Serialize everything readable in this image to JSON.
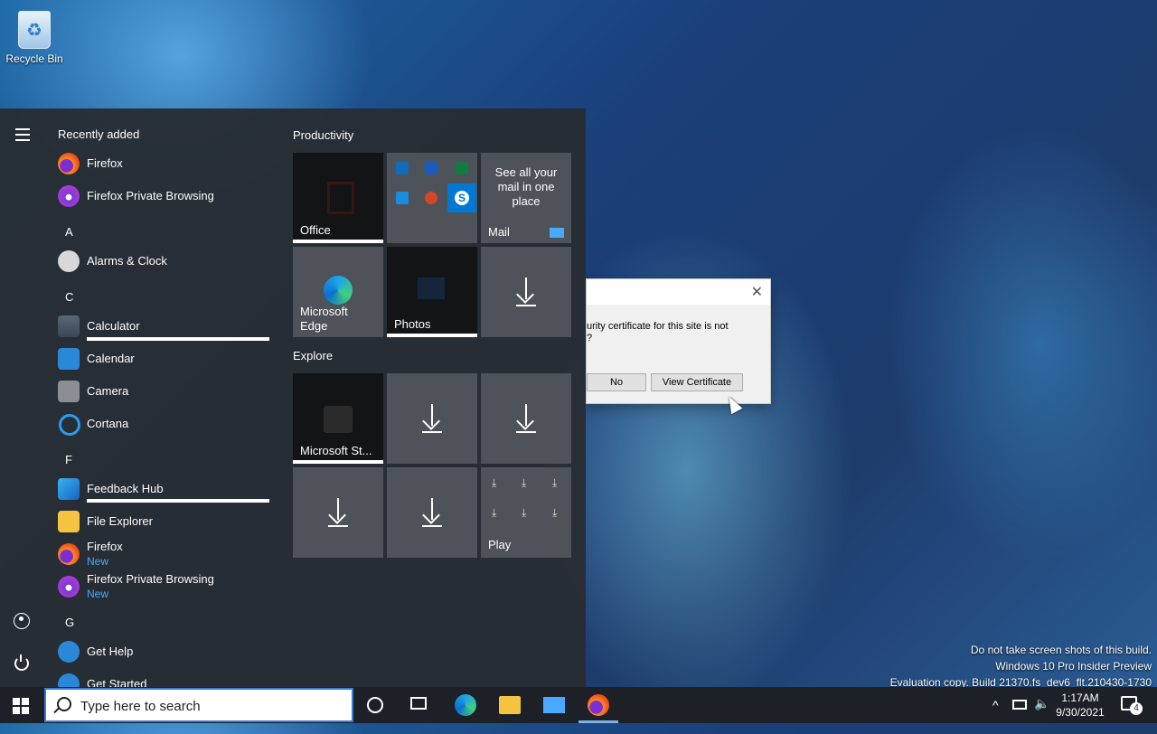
{
  "desktop": {
    "recycle_bin_label": "Recycle Bin",
    "watermark": [
      "Do not take screen shots of this build.",
      "Windows 10 Pro Insider Preview",
      "Evaluation copy. Build 21370.fs_dev6_flt.210430-1730"
    ]
  },
  "dialog": {
    "message_line1": "urity certificate for this site is not",
    "message_line2": "?",
    "no_label": "No",
    "view_cert_label": "View Certificate"
  },
  "start_menu": {
    "recently_added": "Recently added",
    "recent": [
      "Firefox",
      "Firefox Private Browsing"
    ],
    "letters": [
      "A",
      "C",
      "F",
      "G"
    ],
    "apps": {
      "alarms": "Alarms & Clock",
      "calculator": "Calculator",
      "calendar": "Calendar",
      "camera": "Camera",
      "cortana": "Cortana",
      "feedback": "Feedback Hub",
      "file_explorer": "File Explorer",
      "firefox": "Firefox",
      "firefox_private": "Firefox Private Browsing",
      "new_badge": "New",
      "get_help": "Get Help",
      "get_started": "Get Started"
    },
    "groups": {
      "productivity": "Productivity",
      "explore": "Explore"
    },
    "tiles": {
      "office": "Office",
      "mail_promo": "See all your mail in one place",
      "mail": "Mail",
      "edge": "Microsoft Edge",
      "photos": "Photos",
      "store": "Microsoft St...",
      "play": "Play"
    }
  },
  "taskbar": {
    "search_placeholder": "Type here to search",
    "time": "1:17AM",
    "date": "9/30/2021",
    "notification_count": "4"
  }
}
